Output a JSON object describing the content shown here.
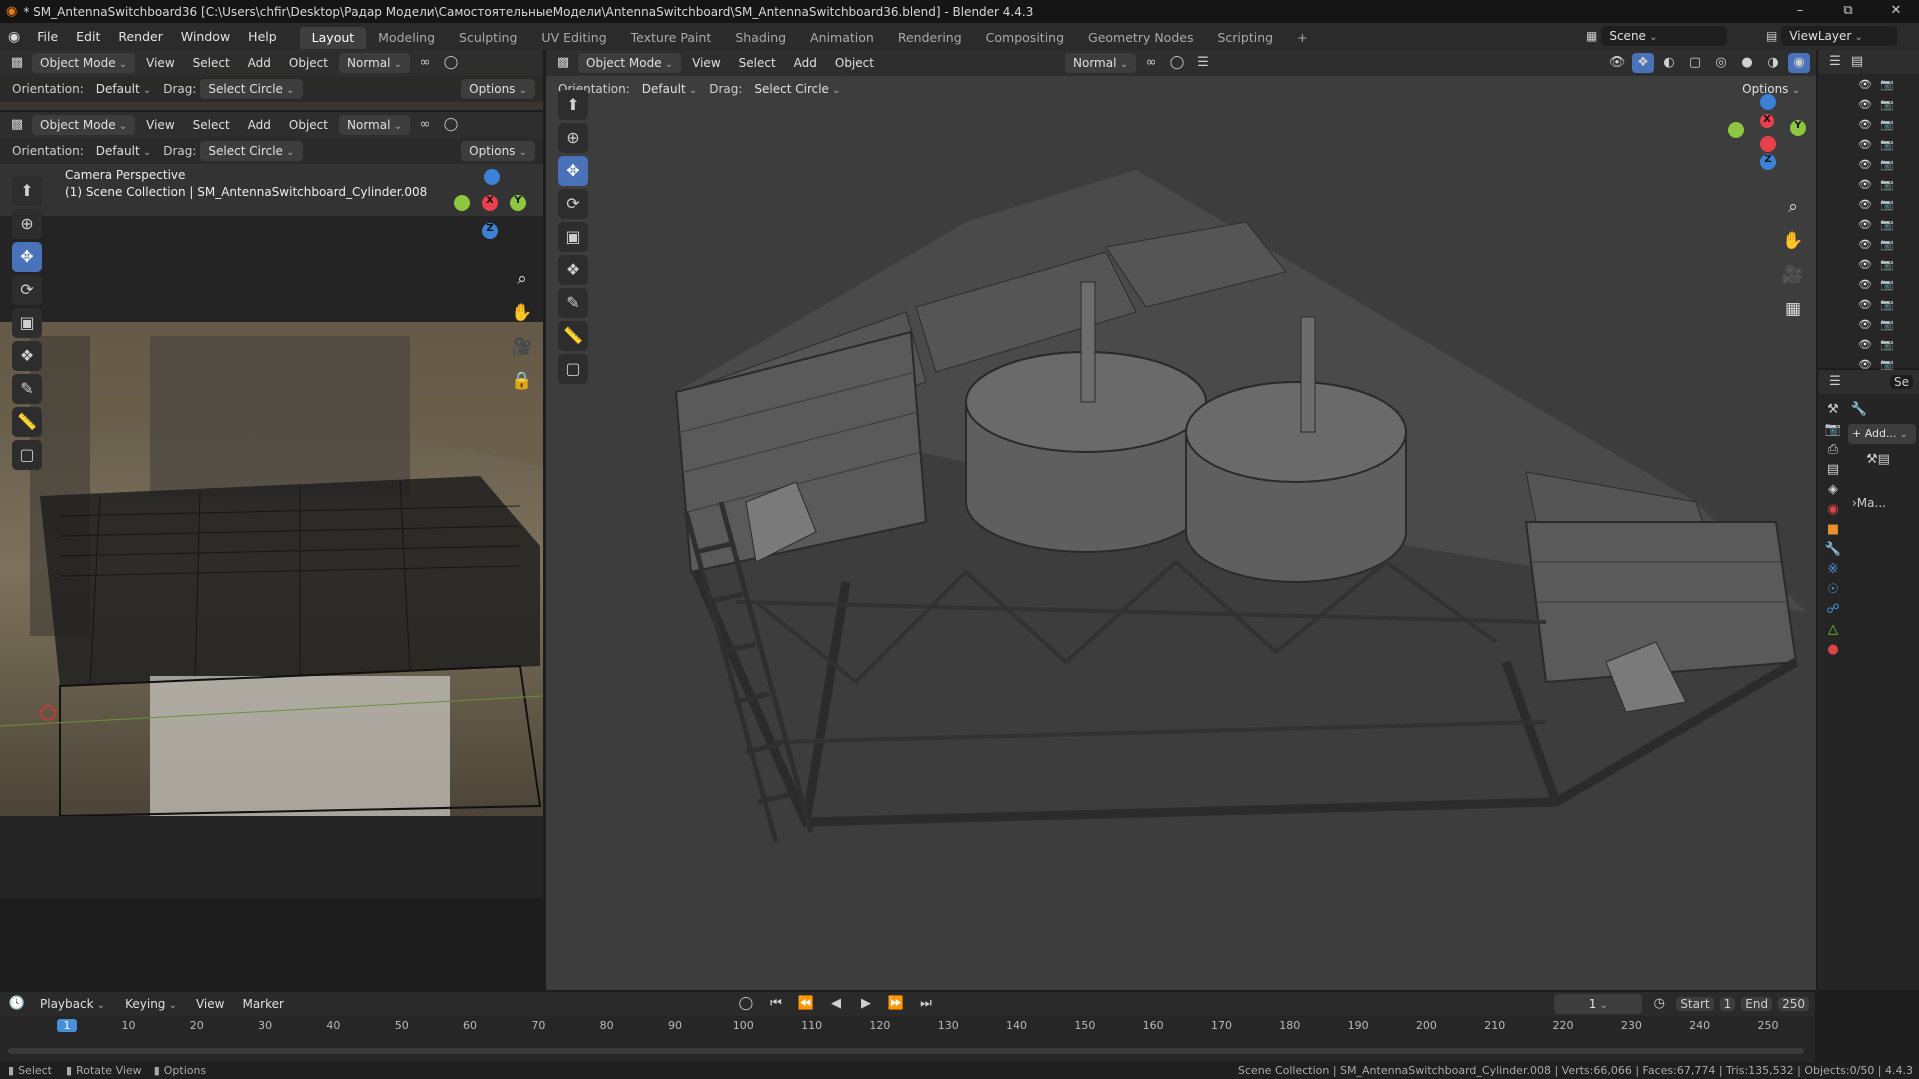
{
  "titlebar": {
    "title": "* SM_AntennaSwitchboard36 [C:\\Users\\chfir\\Desktop\\Радар Модели\\СамостоятельныеМодели\\AntennaSwitchboard\\SM_AntennaSwitchboard36.blend] - Blender 4.4.3",
    "minimize": "–",
    "maximize": "⧉",
    "close": "✕"
  },
  "menubar": {
    "items": [
      "File",
      "Edit",
      "Render",
      "Window",
      "Help"
    ],
    "workspaces": [
      "Layout",
      "Modeling",
      "Sculpting",
      "UV Editing",
      "Texture Paint",
      "Shading",
      "Animation",
      "Rendering",
      "Compositing",
      "Geometry Nodes",
      "Scripting"
    ],
    "active_workspace": "Layout",
    "add_tab": "+",
    "scene_label": "Scene",
    "viewlayer_label": "ViewLayer"
  },
  "viewport_header": {
    "mode": "Object Mode",
    "menus": [
      "View",
      "Select",
      "Add",
      "Object"
    ],
    "orientation_mode": "Normal",
    "orientation_label": "Orientation:",
    "orientation_value": "Default",
    "drag_label": "Drag:",
    "drag_value": "Select Circle",
    "options_label": "Options"
  },
  "left_viewport": {
    "info_line1": "Camera Perspective",
    "info_line2": "(1) Scene Collection | SM_AntennaSwitchboard_Cylinder.008"
  },
  "gizmo": {
    "x": "X",
    "y": "Y",
    "z": "Z"
  },
  "tools": [
    "select-box",
    "cursor",
    "move",
    "rotate",
    "scale",
    "transform",
    "annotate",
    "measure",
    "add-cube"
  ],
  "properties": {
    "add_label": "+ Add...",
    "modifier_label": "›Ma...",
    "search_placeholder": "Se"
  },
  "timeline": {
    "menus": [
      "Playback",
      "Keying",
      "View",
      "Marker"
    ],
    "current_frame": "1",
    "start_label": "Start",
    "start_value": "1",
    "end_label": "End",
    "end_value": "250",
    "ticks": [
      "1",
      "10",
      "20",
      "30",
      "40",
      "50",
      "60",
      "70",
      "80",
      "90",
      "100",
      "110",
      "120",
      "130",
      "140",
      "150",
      "160",
      "170",
      "180",
      "190",
      "200",
      "210",
      "220",
      "230",
      "240",
      "250"
    ]
  },
  "statusbar": {
    "select": "Select",
    "rotate": "Rotate View",
    "options": "Options",
    "stats": "Scene Collection | SM_AntennaSwitchboard_Cylinder.008 | Verts:66,066 | Faces:67,774 | Tris:135,532 | Objects:0/50 | 4.4.3"
  },
  "colors": {
    "accent": "#4a72b8",
    "frame_marker": "#4a90d9",
    "x_axis": "#e8414c",
    "y_axis": "#8ec63f",
    "z_axis": "#3b82d6"
  }
}
